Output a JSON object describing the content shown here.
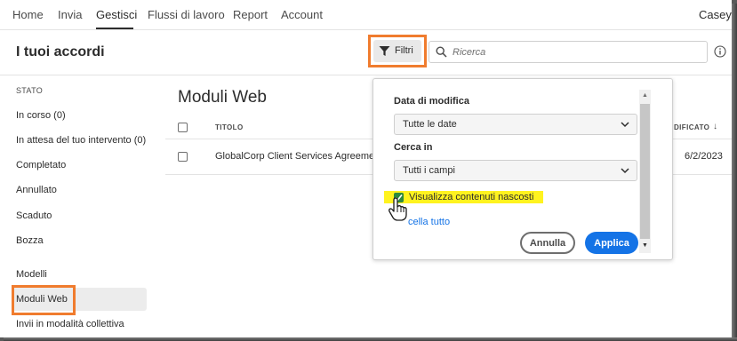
{
  "nav": {
    "items": [
      "Home",
      "Invia",
      "Gestisci",
      "Flussi di lavoro",
      "Report",
      "Account"
    ],
    "active": "Gestisci",
    "user": "Casey"
  },
  "header": {
    "title": "I tuoi accordi",
    "filter_label": "Filtri",
    "search_placeholder": "Ricerca"
  },
  "sidebar": {
    "heading": "STATO",
    "items": [
      "In corso (0)",
      "In attesa del tuo intervento (0)",
      "Completato",
      "Annullato",
      "Scaduto",
      "Bozza",
      "Modelli",
      "Moduli Web",
      "Invii in modalità collettiva"
    ],
    "selected": "Moduli Web"
  },
  "main": {
    "title": "Moduli Web",
    "columns": {
      "title": "TITOLO",
      "modified": "DIFICATO"
    },
    "rows": [
      {
        "title": "GlobalCorp Client Services Agreement",
        "date": "6/2/2023"
      }
    ]
  },
  "filter_panel": {
    "date_label": "Data di modifica",
    "date_value": "Tutte le date",
    "search_in_label": "Cerca in",
    "search_in_value": "Tutti i campi",
    "show_hidden_label": "Visualizza contenuti nascosti",
    "show_hidden_checked": true,
    "clear_all": "cella tutto",
    "cancel": "Annulla",
    "apply": "Applica"
  },
  "colors": {
    "accent": "#1473e6",
    "highlight_box": "#f07c2e",
    "highlight_text": "#fff31f",
    "checkbox": "#2d8a3e"
  }
}
